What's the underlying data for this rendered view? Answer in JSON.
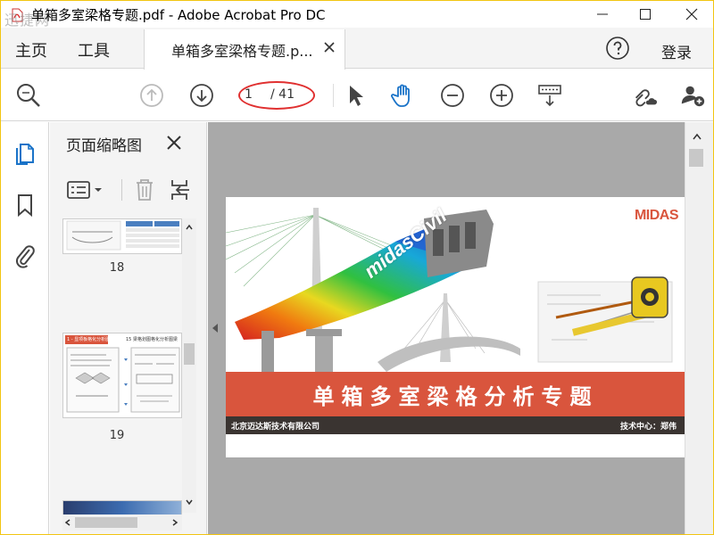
{
  "window": {
    "title": "单箱多室梁格专题.pdf - Adobe Acrobat Pro DC",
    "watermark": "迅捷网"
  },
  "menubar": {
    "home": "主页",
    "tools": "工具",
    "doc_tab": "单箱多室梁格专题.p...",
    "login": "登录"
  },
  "toolbar": {
    "current_page": "1",
    "total_pages": "/ 41"
  },
  "thumbnails": {
    "title": "页面缩略图",
    "items": [
      {
        "number": "18"
      },
      {
        "number": "19"
      }
    ],
    "thumb19_header": "1 - 显项板格化分析图",
    "thumb19_subheader": "15 梁格划图格化分析图梁"
  },
  "document": {
    "logo": "MIDAS",
    "software_name": "midasCivil",
    "banner": "单箱多室梁格分析专题",
    "footer_left": "北京迈达斯技术有限公司",
    "footer_right": "技术中心：郑伟"
  },
  "colors": {
    "accent_red": "#d9553d",
    "annotation": "#e03030",
    "hand_tool": "#1a73c8"
  }
}
